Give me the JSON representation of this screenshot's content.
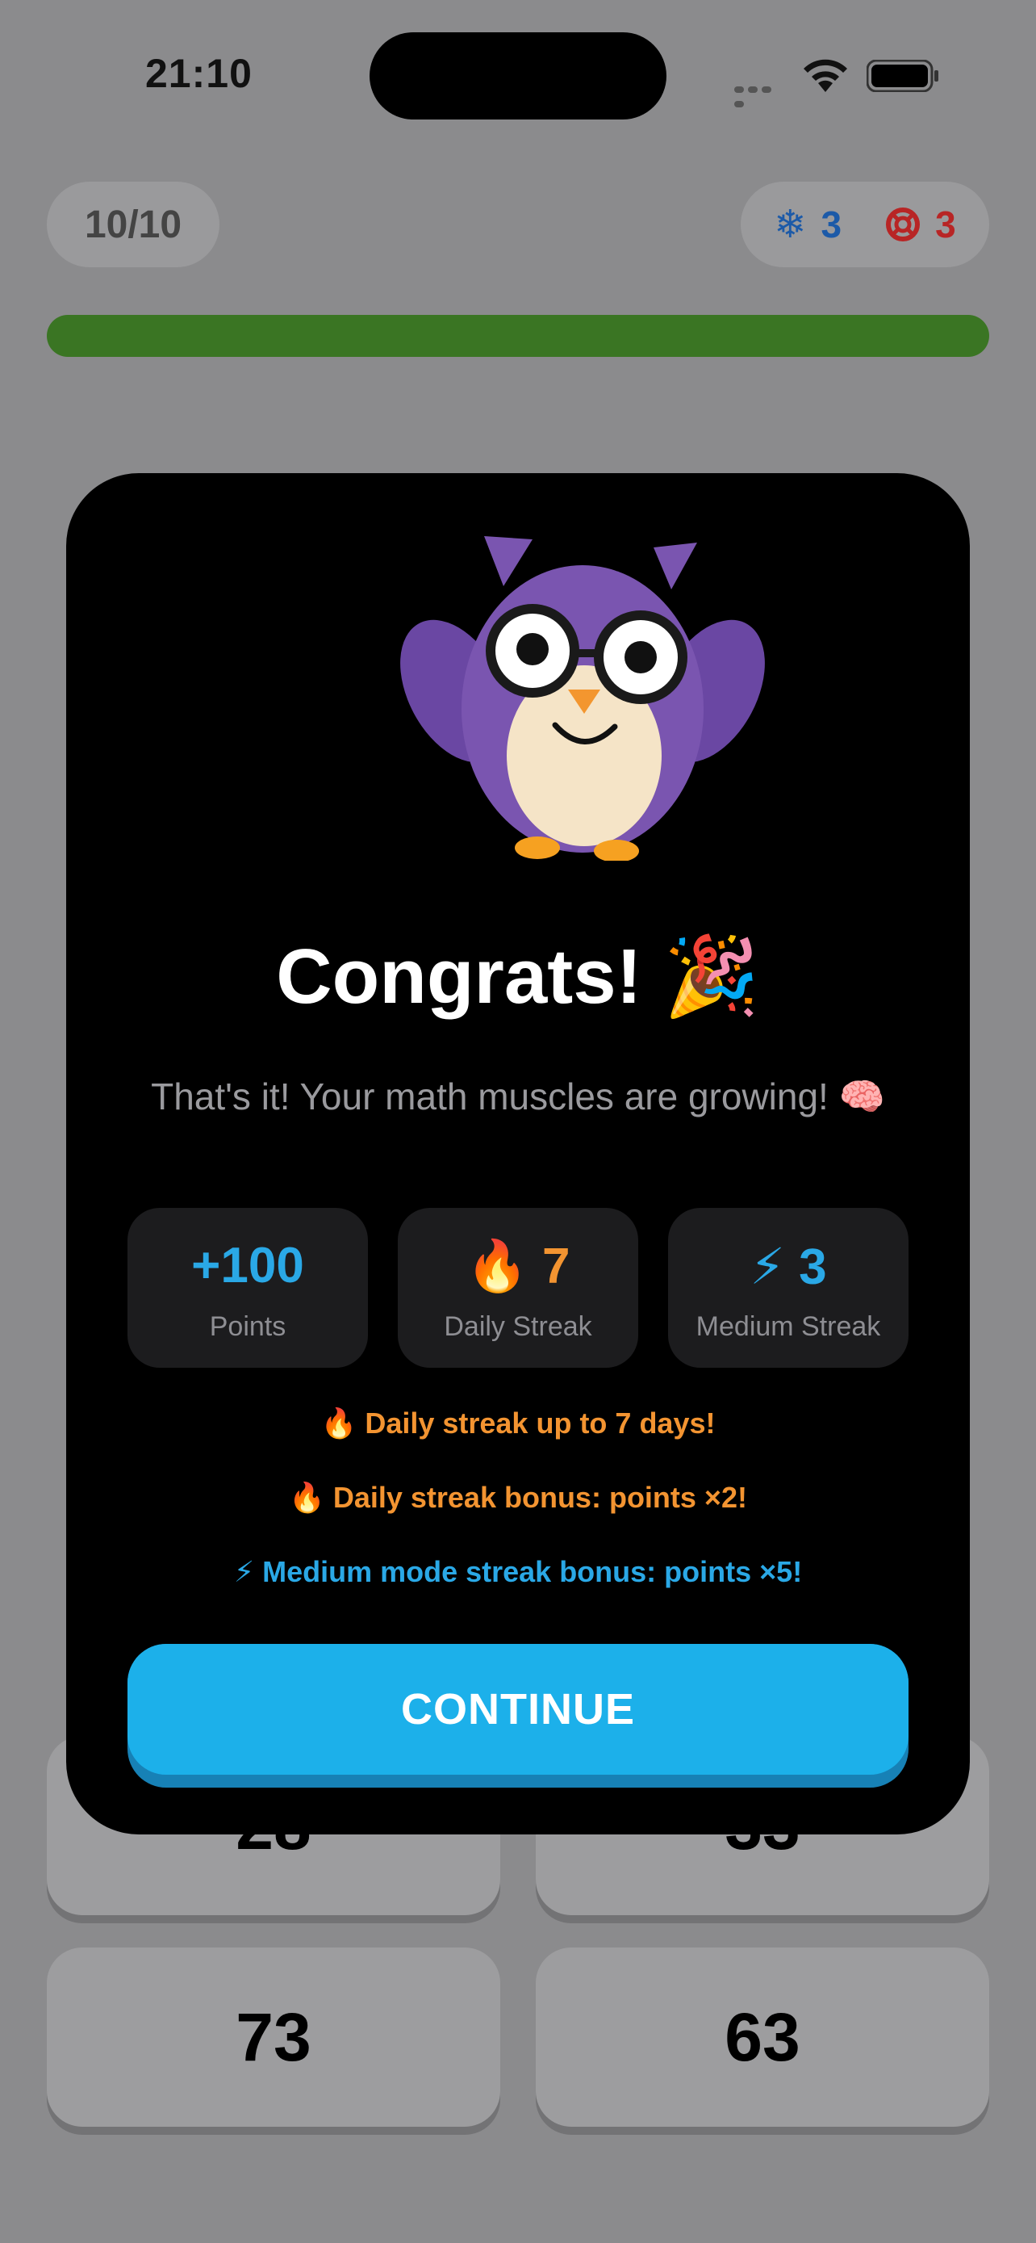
{
  "status_bar": {
    "time": "21:10"
  },
  "header": {
    "progress_label": "10/10",
    "freezes": {
      "icon": "❄",
      "count": "3"
    },
    "lives": {
      "count": "3"
    },
    "progress_fraction": 1.0
  },
  "answers": [
    "28",
    "33",
    "73",
    "63"
  ],
  "modal": {
    "title": "Congrats! 🎉",
    "subtitle": "That's it! Your math muscles are growing! 🧠",
    "stats": [
      {
        "value": "+100",
        "label": "Points",
        "color": "#2aa8e6"
      },
      {
        "value": "🔥 7",
        "label": "Daily Streak",
        "color": "#f39431"
      },
      {
        "value": "⚡ 3",
        "label": "Medium Streak",
        "color": "#2aa8e6"
      }
    ],
    "bonuses": [
      {
        "text": "🔥 Daily streak up to 7 days!",
        "color": "#f39431"
      },
      {
        "text": "🔥 Daily streak bonus: points ×2!",
        "color": "#f39431"
      },
      {
        "text": "⚡ Medium mode streak bonus: points ×5!",
        "color": "#2aa8e6"
      }
    ],
    "continue_label": "CONTINUE"
  },
  "colors": {
    "accent_blue": "#1cb0ea",
    "progress_green": "#3a7523",
    "streak_orange": "#f39431",
    "mascot_purple": "#7a55b0"
  }
}
